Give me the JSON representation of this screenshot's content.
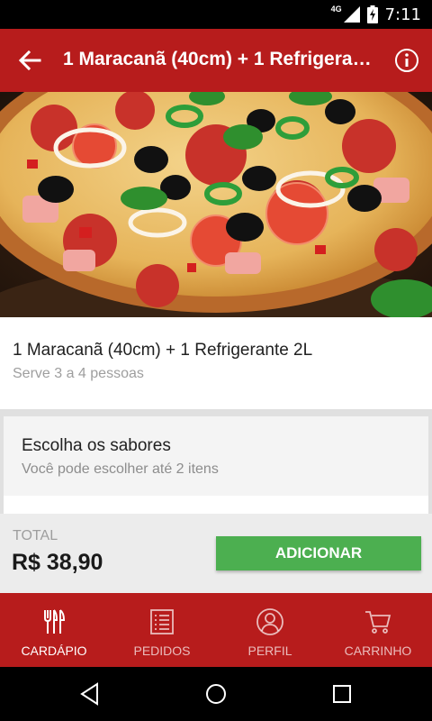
{
  "status_bar": {
    "network": "4G",
    "time": "7:11"
  },
  "app_bar": {
    "title": "1 Maracanã (40cm) + 1 Refrigerante 2L",
    "back_icon": "arrow-left-icon",
    "info_icon": "info-circle-icon"
  },
  "product": {
    "name": "1 Maracanã (40cm) + 1 Refrigerante 2L",
    "description": "Serve 3 a 4 pessoas"
  },
  "options": {
    "heading": "Escolha os sabores",
    "subheading": "Você pode escolher até 2 itens"
  },
  "total": {
    "label": "TOTAL",
    "price": "R$ 38,90",
    "add_button": "ADICIONAR"
  },
  "bottom_nav": {
    "items": [
      {
        "label": "CARDÁPIO",
        "icon": "fork-knife-icon",
        "active": true
      },
      {
        "label": "PEDIDOS",
        "icon": "list-icon",
        "active": false
      },
      {
        "label": "PERFIL",
        "icon": "user-icon",
        "active": false
      },
      {
        "label": "CARRINHO",
        "icon": "cart-icon",
        "active": false
      }
    ]
  },
  "colors": {
    "primary": "#b71c1c",
    "accent_button": "#4caf50",
    "status_bar": "#000000"
  }
}
